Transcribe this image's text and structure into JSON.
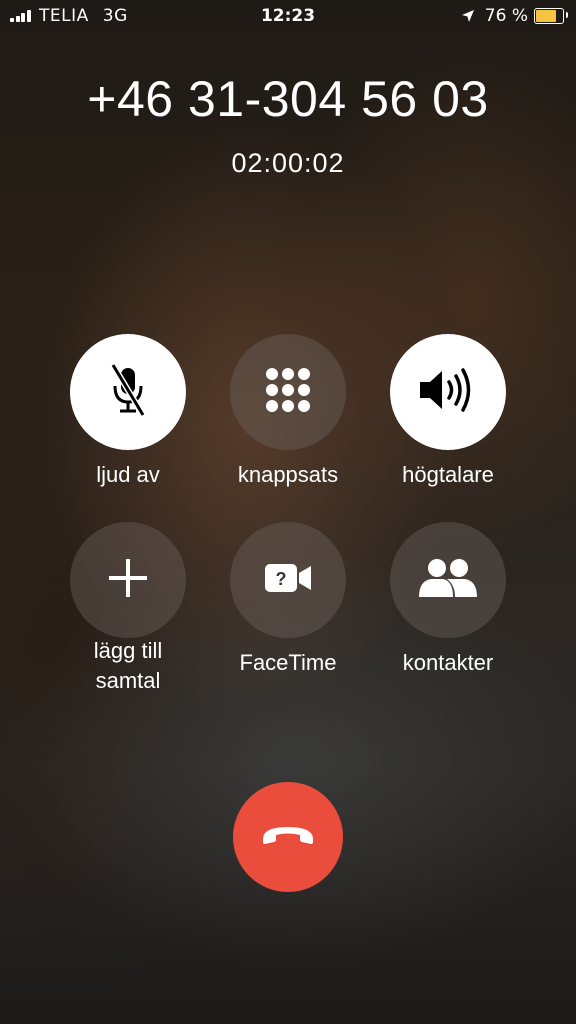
{
  "status_bar": {
    "carrier": "TELIA",
    "network": "3G",
    "time": "12:23",
    "battery_percent": "76 %",
    "battery_level": 0.76,
    "battery_color": "#f5c242"
  },
  "call": {
    "number": "+46 31-304 56 03",
    "duration": "02:00:02"
  },
  "buttons": {
    "mute": {
      "label": "ljud av",
      "icon": "mic-muted-icon",
      "active": true
    },
    "keypad": {
      "label": "knappsats",
      "icon": "keypad-icon",
      "active": false
    },
    "speaker": {
      "label": "högtalare",
      "icon": "speaker-icon",
      "active": true
    },
    "add_call": {
      "label_line1": "lägg till",
      "label_line2": "samtal",
      "icon": "plus-icon",
      "active": false
    },
    "facetime": {
      "label": "FaceTime",
      "icon": "facetime-video-icon",
      "active": false
    },
    "contacts": {
      "label": "kontakter",
      "icon": "contacts-icon",
      "active": false
    }
  },
  "end_call": {
    "icon": "hang-up-icon",
    "color": "#eb4d3d"
  }
}
